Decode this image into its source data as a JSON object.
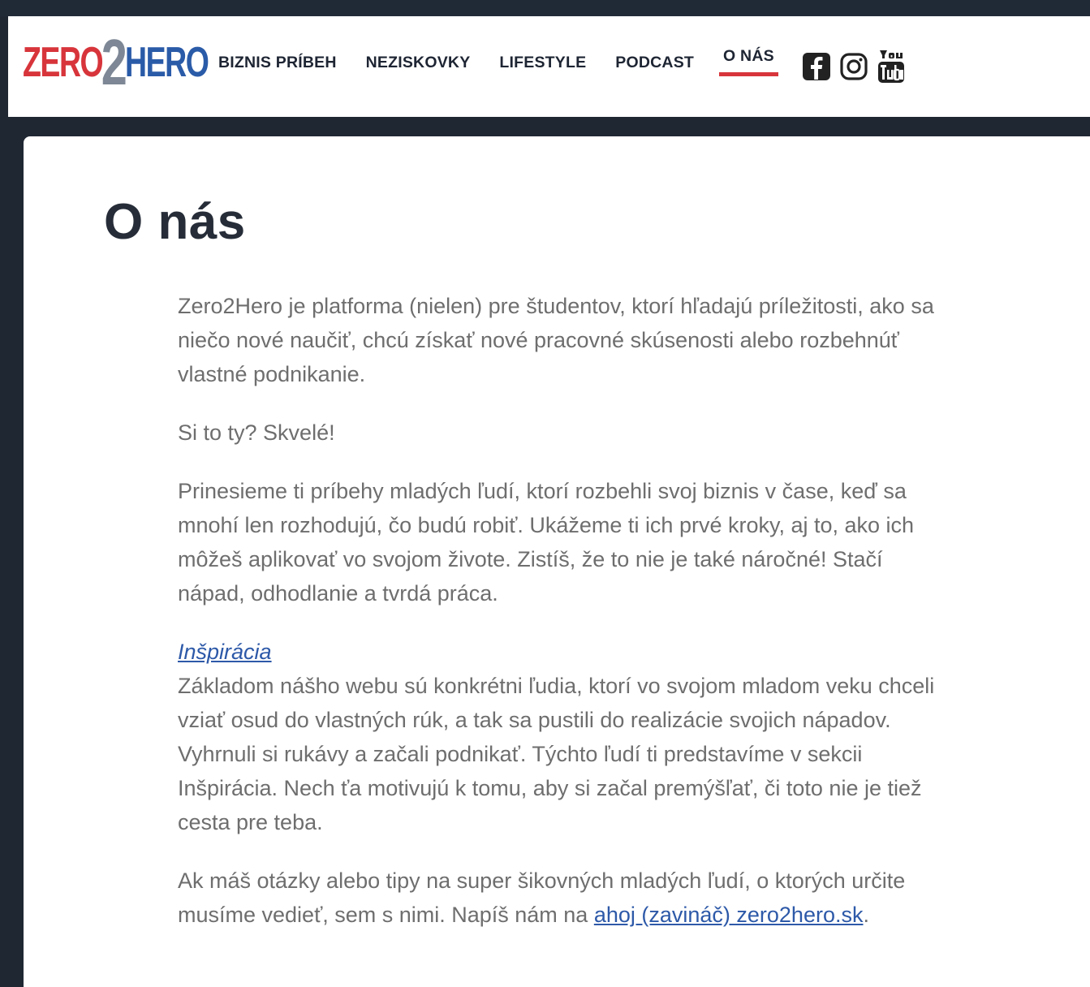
{
  "logo": {
    "part_zero": "ZERO",
    "part_two": "2",
    "part_hero": "HERO"
  },
  "nav": {
    "items": [
      {
        "label": "BIZNIS PRÍBEH"
      },
      {
        "label": "NEZISKOVKY"
      },
      {
        "label": "LIFESTYLE"
      },
      {
        "label": "PODCAST"
      },
      {
        "label": "O NÁS",
        "active": true
      }
    ]
  },
  "social": [
    "facebook-icon",
    "instagram-icon",
    "youtube-icon"
  ],
  "colors": {
    "accent_red": "#d7353b",
    "brand_blue": "#2a5ba8",
    "link_blue": "#2d59a8",
    "body_text": "#6e6e6e",
    "background": "#1f2733"
  },
  "page": {
    "title": "O nás",
    "p1": "Zero2Hero je platforma (nielen) pre študentov, ktorí hľadajú príležitosti, ako sa niečo nové naučiť, chcú získať nové pracovné skúsenosti alebo rozbehnúť vlastné podnikanie.",
    "p2": "Si to ty? Skvelé!",
    "p3": "Prinesieme ti príbehy mladých ľudí, ktorí rozbehli svoj biznis v čase, keď sa mnohí len rozhodujú, čo budú robiť. Ukážeme ti ich prvé kroky, aj to, ako ich môžeš aplikovať vo svojom živote. Zistíš, že to nie je také náročné! Stačí nápad, odhodlanie a tvrdá práca.",
    "inspiracia_link": "Inšpirácia",
    "p4": "Základom nášho webu sú konkrétni ľudia, ktorí vo svojom mladom veku chceli vziať osud do vlastných rúk, a tak sa pustili do realizácie svojich nápadov. Vyhrnuli si rukávy a začali podnikať. Týchto ľudí ti predstavíme v sekcii Inšpirácia. Nech ťa motivujú k tomu, aby si začal premýšľať, či toto nie je tiež cesta pre teba.",
    "p5_before": "Ak máš otázky alebo tipy na super šikovných mladých ľudí, o ktorých určite musíme vedieť, sem s nimi. Napíš nám na ",
    "email_link": "ahoj (zavináč) zero2hero.sk",
    "p5_after": "."
  }
}
